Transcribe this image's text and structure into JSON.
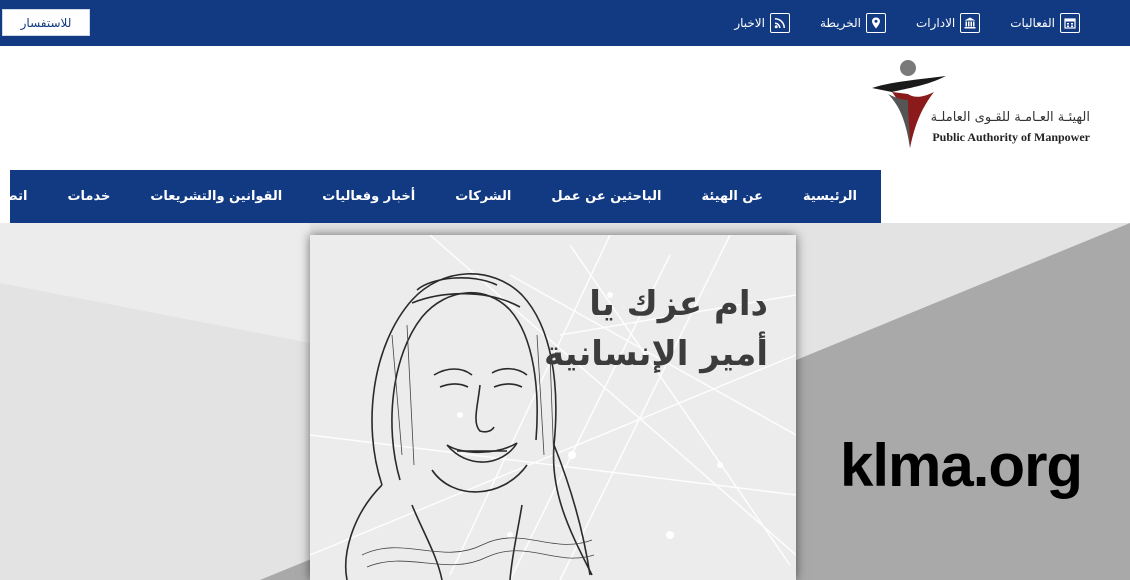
{
  "topbar": {
    "inquiry_label": "للاستفسار",
    "links": [
      {
        "label": "الفعاليات",
        "icon": "calendar-icon"
      },
      {
        "label": "الادارات",
        "icon": "institution-icon"
      },
      {
        "label": "الخريطة",
        "icon": "map-marker-icon"
      },
      {
        "label": "الاخبار",
        "icon": "rss-icon"
      }
    ]
  },
  "logo": {
    "arabic_name": "الهيئـة العـامـة للقـوى العاملـة",
    "english_name": "Public Authority of Manpower"
  },
  "nav": {
    "items": [
      {
        "label": "الرئيسية"
      },
      {
        "label": "عن الهيئة"
      },
      {
        "label": "الباحثين عن عمل"
      },
      {
        "label": "الشركات"
      },
      {
        "label": "أخبار وفعاليات"
      },
      {
        "label": "القوانين والتشريعات"
      },
      {
        "label": "خدمات"
      },
      {
        "label": "اتصل بنا"
      }
    ]
  },
  "hero": {
    "title_line1": "دام عزك يا",
    "title_line2": "أمير الإنسانية",
    "watermark": "klma.org"
  },
  "colors": {
    "primary": "#123a82",
    "hero_bg": "#e3e3e3",
    "hero_wedge": "#a9a9a9",
    "logo_red": "#8b1a1a"
  }
}
